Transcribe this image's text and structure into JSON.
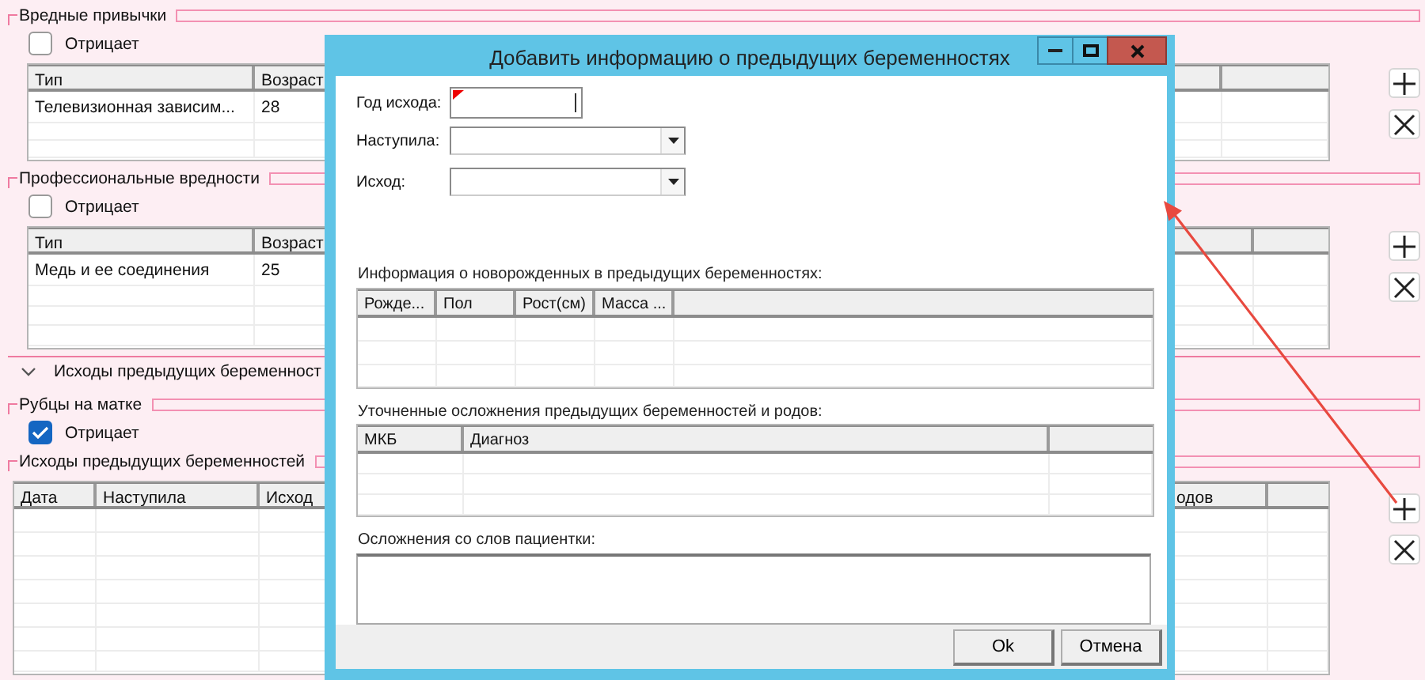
{
  "sections": [
    {
      "kind": "group",
      "title": "Вредные привычки",
      "checkbox": {
        "label": "Отрицает",
        "checked": false
      },
      "table": {
        "columns": [
          "Тип",
          "Возраст"
        ],
        "rows": [
          [
            "Телевизионная зависим...",
            "28"
          ]
        ]
      }
    },
    {
      "kind": "group",
      "title": "Профессиональные вредности",
      "checkbox": {
        "label": "Отрицает",
        "checked": false
      },
      "table": {
        "columns": [
          "Тип",
          "Возраст"
        ],
        "rows": [
          [
            "Медь и ее соединения",
            "25"
          ]
        ]
      }
    },
    {
      "kind": "expander",
      "title": "Исходы предыдущих беременност",
      "expanded": true
    },
    {
      "kind": "group",
      "title": "Рубцы на матке",
      "checkbox": {
        "label": "Отрицает",
        "checked": true
      }
    },
    {
      "kind": "group",
      "title": "Исходы предыдущих беременностей",
      "table": {
        "columns": [
          "Дата",
          "Наступила",
          "Исход",
          "одов"
        ]
      }
    }
  ],
  "dialog": {
    "title": "Добавить информацию о предыдущих беременностях",
    "fields": [
      {
        "kind": "text",
        "label": "Год исхода:",
        "required": true
      },
      {
        "kind": "select",
        "label": "Наступила:"
      },
      {
        "kind": "select",
        "label": "Исход:"
      }
    ],
    "newborns": {
      "label": "Информация о новорожденных в предыдущих беременностях:",
      "columns": [
        "Рожде...",
        "Пол",
        "Рост(см)",
        "Масса ..."
      ]
    },
    "complications": {
      "label": "Уточненные осложнения предыдущих беременностей и родов:",
      "columns": [
        "МКБ",
        "Диагноз"
      ]
    },
    "patient_notes": {
      "label": "Осложнения со слов пациентки:"
    },
    "buttons": [
      "Ok",
      "Отмена"
    ]
  }
}
